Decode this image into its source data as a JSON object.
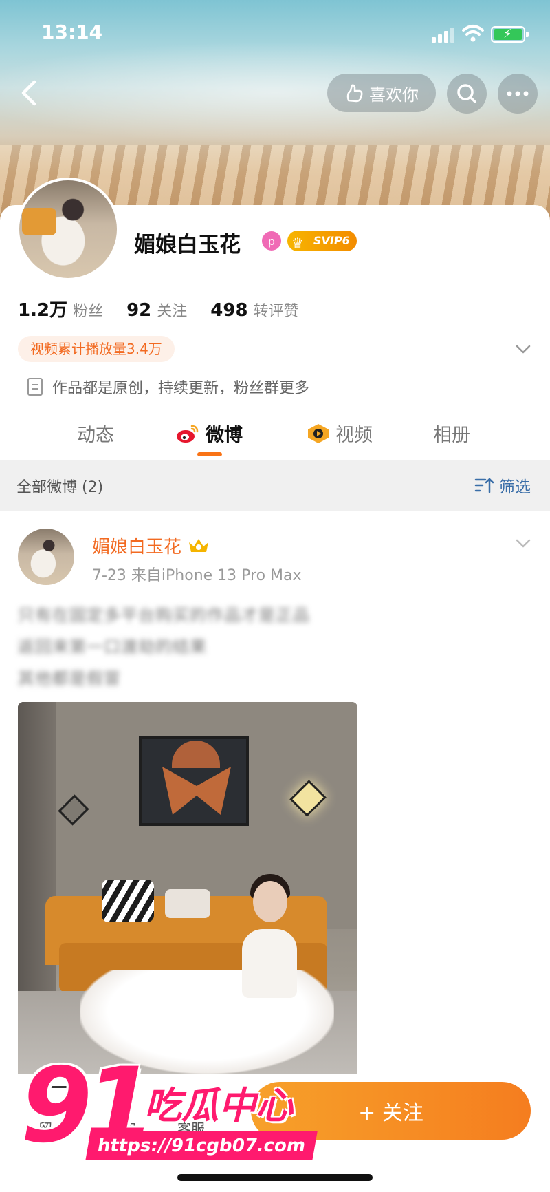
{
  "status_bar": {
    "time": "13:14"
  },
  "header": {
    "like_label": "喜欢你"
  },
  "profile": {
    "name": "媚娘白玉花",
    "pink_badge": "p",
    "svip_label": "SVIP6",
    "stats": [
      {
        "value": "1.2万",
        "label": "粉丝"
      },
      {
        "value": "92",
        "label": "关注"
      },
      {
        "value": "498",
        "label": "转评赞"
      }
    ],
    "video_tag": "视频累计播放量3.4万",
    "bio": "作品都是原创，持续更新，粉丝群更多"
  },
  "tabs": [
    {
      "label": "动态"
    },
    {
      "label": "微博"
    },
    {
      "label": "视频"
    },
    {
      "label": "相册"
    }
  ],
  "filter_bar": {
    "left": "全部微博 (2)",
    "right": "筛选"
  },
  "post": {
    "author": "媚娘白玉花",
    "meta": "7-23  来自iPhone 13 Pro Max",
    "text_lines": [
      "只有在固定多平台购买的作品才是正品",
      "返回来第一口渡劫的结果",
      "其他都是假冒"
    ]
  },
  "bottom_bar": {
    "follow_label": "+ 关注",
    "labels": [
      "留",
      "通知",
      "客服"
    ]
  },
  "watermark": {
    "number": "91",
    "brand": "吃瓜中心",
    "url": "https://91cgb07.com"
  },
  "colors": {
    "accent": "#f97316",
    "follow_button": "#f5841f",
    "watermark": "#ff1a6e",
    "link_blue": "#3a6ea8"
  },
  "icons": [
    "back-arrow-icon",
    "like-hand-icon",
    "search-icon",
    "more-dots-icon",
    "weibo-icon",
    "video-icon",
    "filter-icon",
    "document-icon",
    "chevron-down-icon"
  ]
}
